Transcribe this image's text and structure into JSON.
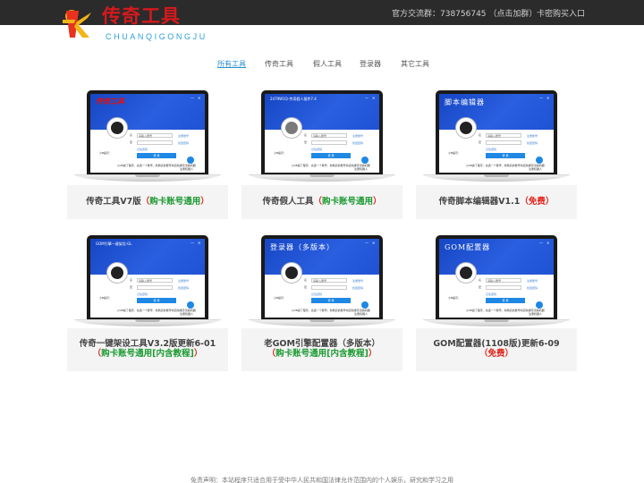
{
  "header": {
    "logo_cn": "传奇工具",
    "logo_en": "CHUANQIGONGJU",
    "qq_group": "官方交流群：738756745 （点击加群）",
    "buy_link": "卡密购买入口"
  },
  "nav": [
    "所有工具",
    "传奇工具",
    "假人工具",
    "登录器",
    "其它工具"
  ],
  "products": [
    {
      "name": "传奇工具V7版",
      "note": "（购卡账号通用）",
      "screen_title": "",
      "screen_title_red": "传奇工具"
    },
    {
      "name": "传奇假人工具",
      "note": "（购卡账号通用）",
      "screen_title": "2479W1Q-传奇假人插件7.4",
      "screen_title_red": ""
    },
    {
      "name": "传奇脚本编辑器V1.1",
      "note": "（免费）",
      "screen_title": "脚本编辑器",
      "screen_title_red": ""
    },
    {
      "name": "传奇一键架设工具V3.2版更新6-01",
      "note": "（购卡账号通用[内含教程]）",
      "screen_title": "GOM引擎一键架设-GL",
      "screen_title_red": ""
    },
    {
      "name": "老GOM引擎配置器（多版本）",
      "note": "（购卡账号通用[内含教程]）",
      "screen_title": "登录器（多版本）",
      "screen_title_red": ""
    },
    {
      "name": "GOM配置器(1108版)更新6-09",
      "note": "（免费）",
      "screen_title": "GOM配置器",
      "screen_title_red": ""
    }
  ],
  "login_form": {
    "account_label": "名",
    "password_label": "密",
    "account_placeholder": "请输入账号",
    "register_link": "注册账号",
    "forgot_link": "找回密码",
    "remember": "记住密码",
    "login_button": "登 录",
    "tip": "小B提示：",
    "footer": "◎VB提了程序，先选一个账号，新购买的账号将自动绑定当前机器",
    "footer2": "注册机器人"
  },
  "footer": "免责声明：本站程序只适合用于受中华人民共和国法律允许范围内的个人娱乐，研究和学习之用",
  "colors": {
    "accent": "#2a8fd0",
    "red": "#e2231a",
    "green": "#1c9a32",
    "topbar": "#2b2b2b"
  }
}
